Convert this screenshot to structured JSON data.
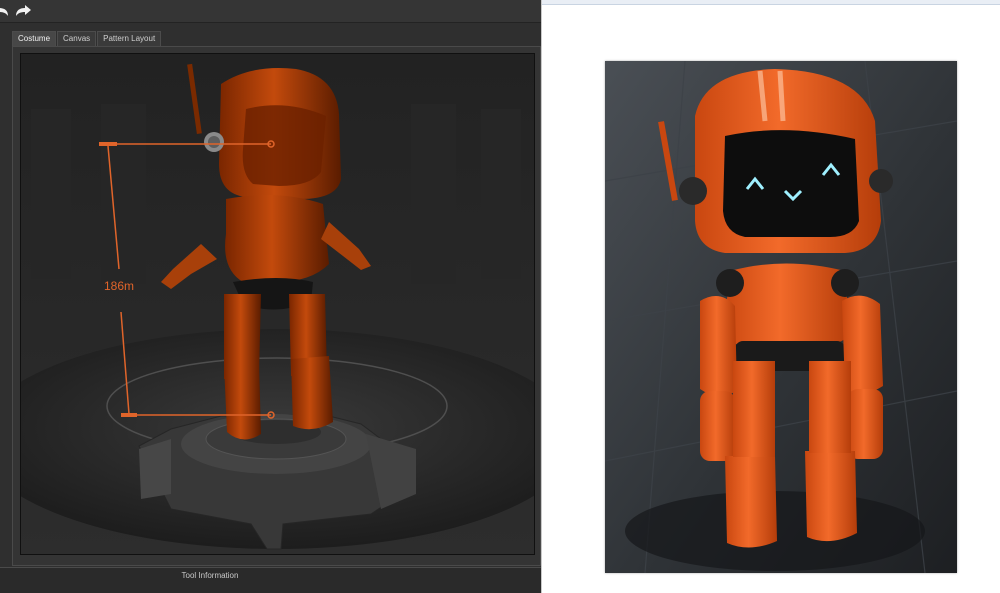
{
  "toolbar": {
    "undo_icon": "undo-arrow-icon",
    "redo_icon": "redo-arrow-icon"
  },
  "tabs": [
    {
      "label": "Costume",
      "active": true
    },
    {
      "label": "Canvas",
      "active": false
    },
    {
      "label": "Pattern Layout",
      "active": false
    }
  ],
  "viewport": {
    "height_measure": "186m",
    "accent_color": "#e0642a"
  },
  "status_bar": {
    "label": "Tool Information"
  },
  "reference": {
    "subject": "orange-robot-photo"
  }
}
